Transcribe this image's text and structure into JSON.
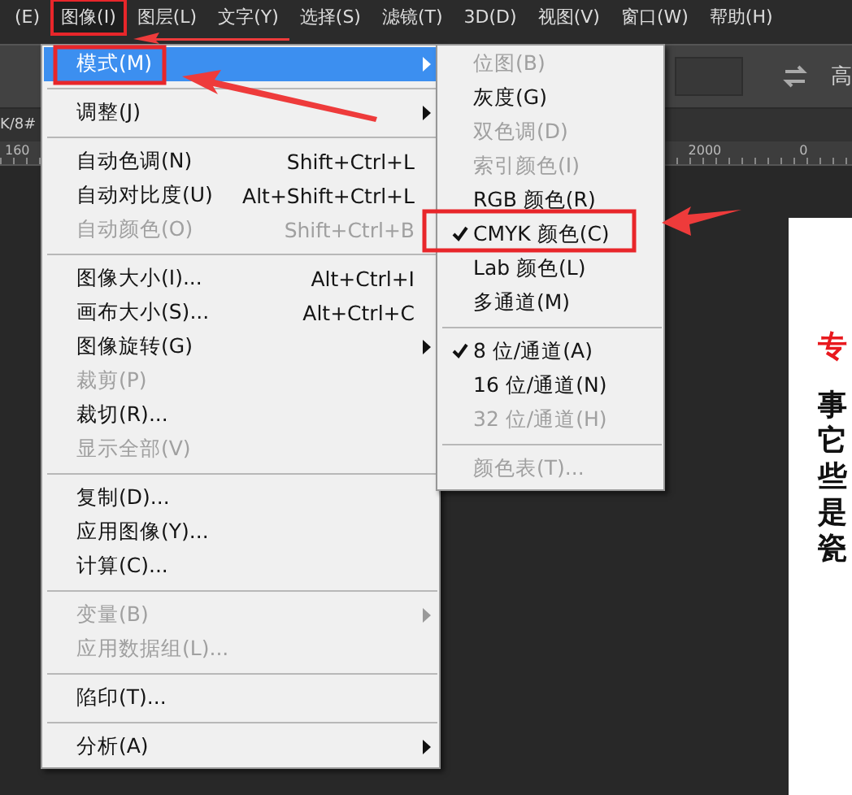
{
  "menu_bar": [
    {
      "label": "(E)",
      "selected": false
    },
    {
      "label": "图像(I)",
      "selected": true
    },
    {
      "label": "图层(L)",
      "selected": false
    },
    {
      "label": "文字(Y)",
      "selected": false
    },
    {
      "label": "选择(S)",
      "selected": false
    },
    {
      "label": "滤镜(T)",
      "selected": false
    },
    {
      "label": "3D(D)",
      "selected": false
    },
    {
      "label": "视图(V)",
      "selected": false
    },
    {
      "label": "窗口(W)",
      "selected": false
    },
    {
      "label": "帮助(H)",
      "selected": false
    }
  ],
  "options_bar": {
    "label": "高"
  },
  "document_tab": {
    "title": "K/8#"
  },
  "ruler": {
    "labels": [
      "160",
      "2000",
      "0"
    ]
  },
  "document": {
    "lines": [
      {
        "text": "专",
        "kind": "heading"
      },
      {
        "text": "事",
        "kind": "body"
      },
      {
        "text": "它",
        "kind": "body"
      },
      {
        "text": "些",
        "kind": "body"
      },
      {
        "text": "是",
        "kind": "body"
      },
      {
        "text": "瓷",
        "kind": "body"
      }
    ]
  },
  "image_menu": [
    {
      "kind": "item",
      "label": "模式(M)",
      "submenu": true,
      "selected": true,
      "disabled": false
    },
    {
      "kind": "separator"
    },
    {
      "kind": "item",
      "label": "调整(J)",
      "submenu": true,
      "selected": false,
      "disabled": false
    },
    {
      "kind": "separator"
    },
    {
      "kind": "item",
      "label": "自动色调(N)",
      "shortcut": "Shift+Ctrl+L",
      "selected": false,
      "disabled": false
    },
    {
      "kind": "item",
      "label": "自动对比度(U)",
      "shortcut": "Alt+Shift+Ctrl+L",
      "selected": false,
      "disabled": false
    },
    {
      "kind": "item",
      "label": "自动颜色(O)",
      "shortcut": "Shift+Ctrl+B",
      "selected": false,
      "disabled": true
    },
    {
      "kind": "separator"
    },
    {
      "kind": "item",
      "label": "图像大小(I)...",
      "shortcut": "Alt+Ctrl+I",
      "selected": false,
      "disabled": false
    },
    {
      "kind": "item",
      "label": "画布大小(S)...",
      "shortcut": "Alt+Ctrl+C",
      "selected": false,
      "disabled": false
    },
    {
      "kind": "item",
      "label": "图像旋转(G)",
      "submenu": true,
      "selected": false,
      "disabled": false
    },
    {
      "kind": "item",
      "label": "裁剪(P)",
      "selected": false,
      "disabled": true
    },
    {
      "kind": "item",
      "label": "裁切(R)...",
      "selected": false,
      "disabled": false
    },
    {
      "kind": "item",
      "label": "显示全部(V)",
      "selected": false,
      "disabled": true
    },
    {
      "kind": "separator"
    },
    {
      "kind": "item",
      "label": "复制(D)...",
      "selected": false,
      "disabled": false
    },
    {
      "kind": "item",
      "label": "应用图像(Y)...",
      "selected": false,
      "disabled": false
    },
    {
      "kind": "item",
      "label": "计算(C)...",
      "selected": false,
      "disabled": false
    },
    {
      "kind": "separator"
    },
    {
      "kind": "item",
      "label": "变量(B)",
      "submenu": true,
      "selected": false,
      "disabled": true
    },
    {
      "kind": "item",
      "label": "应用数据组(L)...",
      "selected": false,
      "disabled": true
    },
    {
      "kind": "separator"
    },
    {
      "kind": "item",
      "label": "陷印(T)...",
      "selected": false,
      "disabled": false
    },
    {
      "kind": "separator"
    },
    {
      "kind": "item",
      "label": "分析(A)",
      "submenu": true,
      "selected": false,
      "disabled": false
    }
  ],
  "mode_submenu": [
    {
      "kind": "item",
      "label": "位图(B)",
      "checked": false,
      "disabled": true
    },
    {
      "kind": "item",
      "label": "灰度(G)",
      "checked": false,
      "disabled": false
    },
    {
      "kind": "item",
      "label": "双色调(D)",
      "checked": false,
      "disabled": true
    },
    {
      "kind": "item",
      "label": "索引颜色(I)",
      "checked": false,
      "disabled": true
    },
    {
      "kind": "item",
      "label": "RGB 颜色(R)",
      "checked": false,
      "disabled": false
    },
    {
      "kind": "item",
      "label": "CMYK 颜色(C)",
      "checked": true,
      "disabled": false
    },
    {
      "kind": "item",
      "label": "Lab 颜色(L)",
      "checked": false,
      "disabled": false
    },
    {
      "kind": "item",
      "label": "多通道(M)",
      "checked": false,
      "disabled": false
    },
    {
      "kind": "separator"
    },
    {
      "kind": "item",
      "label": "8 位/通道(A)",
      "checked": true,
      "disabled": false
    },
    {
      "kind": "item",
      "label": "16 位/通道(N)",
      "checked": false,
      "disabled": false
    },
    {
      "kind": "item",
      "label": "32 位/通道(H)",
      "checked": false,
      "disabled": true
    },
    {
      "kind": "separator"
    },
    {
      "kind": "item",
      "label": "颜色表(T)...",
      "checked": false,
      "disabled": true
    }
  ]
}
